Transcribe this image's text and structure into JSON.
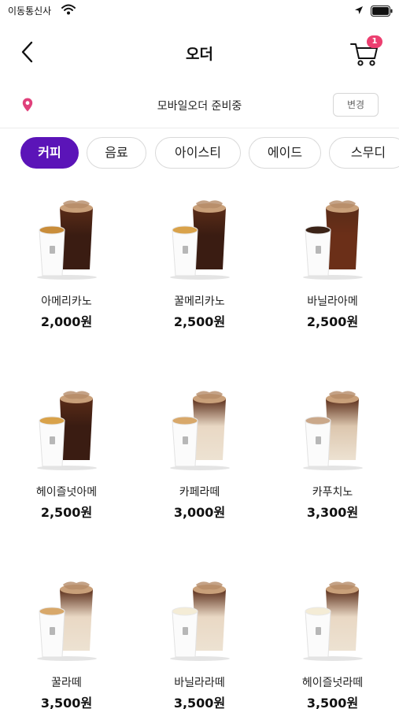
{
  "status_bar": {
    "carrier": "이동통신사"
  },
  "header": {
    "title": "오더",
    "cart_count": "1"
  },
  "store": {
    "status": "모바일오더 준비중",
    "change_label": "변경"
  },
  "colors": {
    "accent": "#5b14b8",
    "badge": "#ec3f70",
    "pin": "#e0407b"
  },
  "tabs": [
    {
      "label": "커피",
      "active": true
    },
    {
      "label": "음료",
      "active": false
    },
    {
      "label": "아이스티",
      "active": false
    },
    {
      "label": "에이드",
      "active": false
    },
    {
      "label": "스무디",
      "active": false
    }
  ],
  "products": [
    {
      "name": "아메리카노",
      "price": "2,000원",
      "hot": "americano",
      "iced": "dark"
    },
    {
      "name": "꿀메리카노",
      "price": "2,500원",
      "hot": "honey",
      "iced": "dark"
    },
    {
      "name": "바닐라아메",
      "price": "2,500원",
      "hot": "dark",
      "iced": "amber"
    },
    {
      "name": "헤이즐넛아메",
      "price": "2,500원",
      "hot": "honey",
      "iced": "dark"
    },
    {
      "name": "카페라떼",
      "price": "3,000원",
      "hot": "latte",
      "iced": "latte"
    },
    {
      "name": "카푸치노",
      "price": "3,300원",
      "hot": "cappuccino",
      "iced": "cappuccino"
    },
    {
      "name": "꿀라떼",
      "price": "3,500원",
      "hot": "latte",
      "iced": "latte"
    },
    {
      "name": "바닐라라떼",
      "price": "3,500원",
      "hot": "vanilla",
      "iced": "latte"
    },
    {
      "name": "헤이즐넛라떼",
      "price": "3,500원",
      "hot": "vanilla",
      "iced": "latte"
    }
  ]
}
